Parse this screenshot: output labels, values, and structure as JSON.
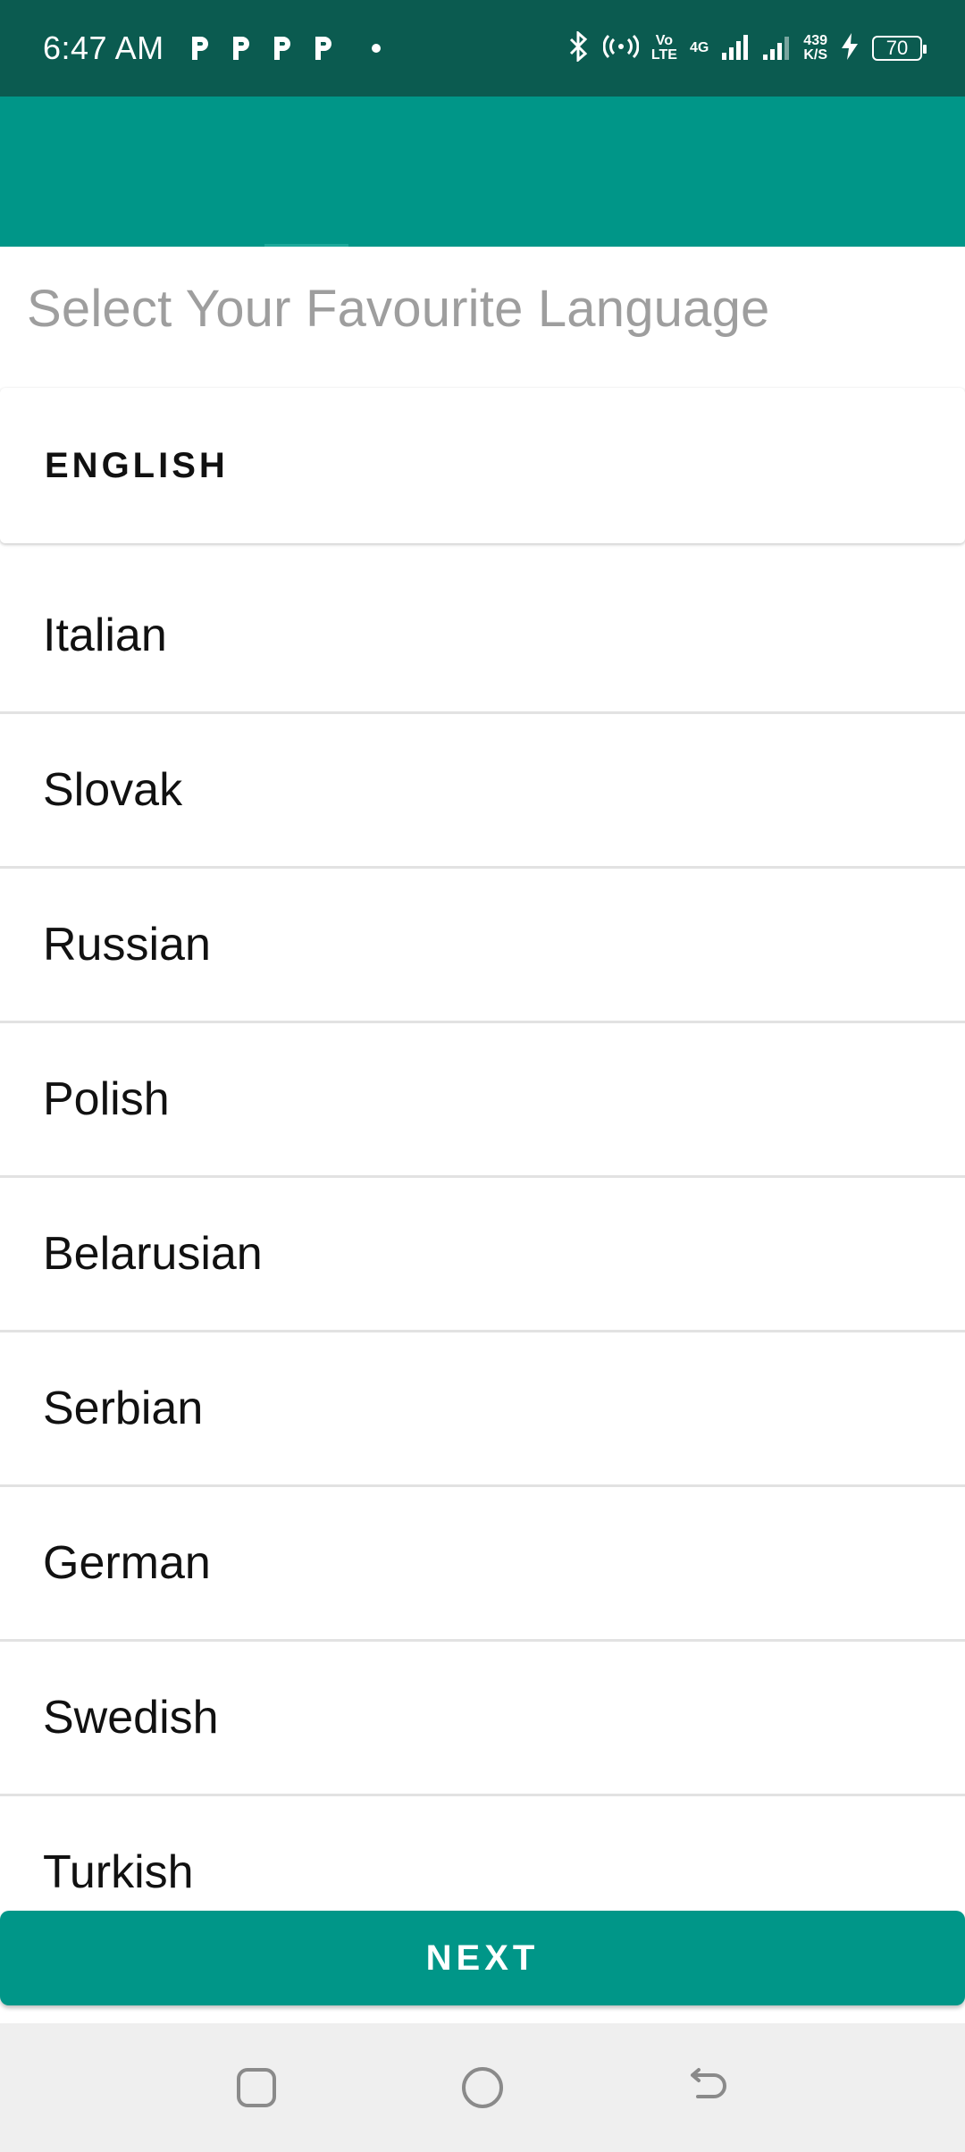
{
  "status_bar": {
    "time": "6:47 AM",
    "network_top": "Vo",
    "network_bottom": "LTE",
    "gen": "4G",
    "speed_value": "439",
    "speed_unit": "K/S",
    "battery": "70"
  },
  "heading": "Select Your Favourite Language",
  "selected_language": "ENGLISH",
  "languages": [
    "Italian",
    "Slovak",
    "Russian",
    "Polish",
    "Belarusian",
    "Serbian",
    "German",
    "Swedish",
    "Turkish"
  ],
  "next_button": "NEXT",
  "colors": {
    "status_bar": "#0b5b50",
    "primary": "#009688",
    "heading_text": "#9e9e9e",
    "nav_bar": "#efefef"
  },
  "icons": [
    "parking-icon",
    "bluetooth-icon",
    "hotspot-icon",
    "signal-icon",
    "charging-icon",
    "battery-icon",
    "recents-icon",
    "home-icon",
    "back-icon"
  ]
}
